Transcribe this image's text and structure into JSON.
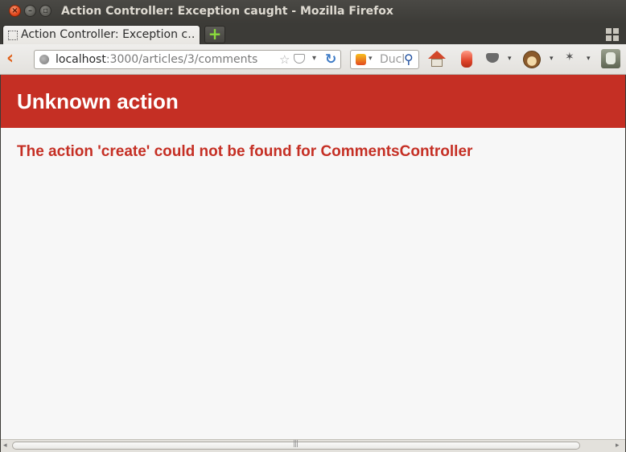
{
  "window": {
    "title": "Action Controller: Exception caught - Mozilla Firefox",
    "close_glyph": "×",
    "minimize_glyph": "–",
    "maximize_glyph": "▫"
  },
  "tabs": [
    {
      "label": "Action Controller: Exception c…",
      "active": true
    }
  ],
  "new_tab_glyph": "+",
  "navbar": {
    "back_glyph": "‹",
    "url_host": "localhost",
    "url_path": ":3000/articles/3/comments",
    "star_glyph": "☆",
    "dropdown_glyph": "▾",
    "reload_glyph": "↻",
    "search_text": "DuckDuckGo",
    "search_glyph": "⚲",
    "fly_glyph": "✶"
  },
  "page": {
    "heading": "Unknown action",
    "message": "The action 'create' could not be found for CommentsController",
    "header_color": "#c52f24"
  },
  "scrollbar": {
    "left_glyph": "◂",
    "right_glyph": "▸",
    "grip_glyph": "|||"
  }
}
